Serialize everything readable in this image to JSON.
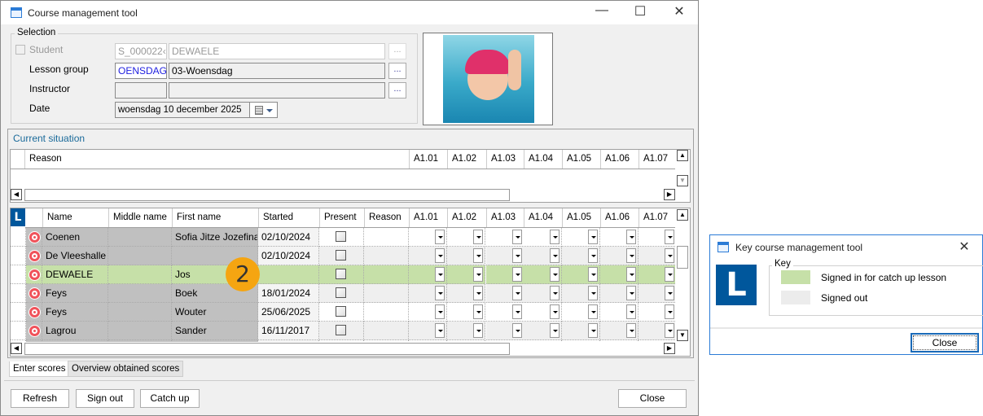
{
  "window": {
    "title": "Course management tool",
    "minimize": "—",
    "maximize": "☐",
    "close": "✕"
  },
  "selection": {
    "legend": "Selection",
    "student": {
      "label": "Student",
      "code": "S_000022‹",
      "name": "DEWAELE",
      "browse": "..."
    },
    "lesson_group": {
      "label": "Lesson group",
      "code": "OENSDAG",
      "name": "03-Woensdag",
      "browse": "..."
    },
    "instructor": {
      "label": "Instructor",
      "code": "",
      "name": "",
      "browse": "..."
    },
    "date": {
      "label": "Date",
      "value": "woensdag 10 december 2025"
    }
  },
  "current_situation": {
    "title": "Current situation",
    "columns": [
      "Reason",
      "A1.01",
      "A1.02",
      "A1.03",
      "A1.04",
      "A1.05",
      "A1.06",
      "A1.07"
    ]
  },
  "grid": {
    "corner": "L",
    "columns": [
      "Name",
      "Middle name",
      "First name",
      "Started",
      "Present",
      "Reason",
      "A1.01",
      "A1.02",
      "A1.03",
      "A1.04",
      "A1.05",
      "A1.06",
      "A1.07"
    ],
    "rows": [
      {
        "name": "Coenen",
        "middle": "",
        "first": "Sofia Jitze Jozefina",
        "started": "02/10/2024",
        "status": "normal"
      },
      {
        "name": "De Vleeshalle",
        "middle": "",
        "first": "",
        "started": "02/10/2024",
        "status": "normal"
      },
      {
        "name": "DEWAELE",
        "middle": "",
        "first": "Jos",
        "started": "",
        "status": "catch_up"
      },
      {
        "name": "Feys",
        "middle": "",
        "first": "Boek",
        "started": "18/01/2024",
        "status": "normal"
      },
      {
        "name": "Feys",
        "middle": "",
        "first": "Wouter",
        "started": "25/06/2025",
        "status": "normal"
      },
      {
        "name": "Lagrou",
        "middle": "",
        "first": "Sander",
        "started": "16/11/2017",
        "status": "normal"
      }
    ]
  },
  "callout": "2",
  "tabs": [
    "Enter scores",
    "Overview obtained scores"
  ],
  "buttons": {
    "refresh": "Refresh",
    "sign_out": "Sign out",
    "catch_up": "Catch up",
    "close": "Close"
  },
  "key_dialog": {
    "title": "Key course management tool",
    "logo": "L",
    "legend": "Key",
    "items": [
      {
        "label": "Signed in for catch up lesson",
        "color": "#c6e0a8"
      },
      {
        "label": "Signed out",
        "color": "#ececec"
      }
    ],
    "close": "Close"
  },
  "colors": {
    "catch_up": "#c6e0a8",
    "signed_out": "#ececec",
    "accent": "#00579c",
    "callout": "#f5a511"
  }
}
